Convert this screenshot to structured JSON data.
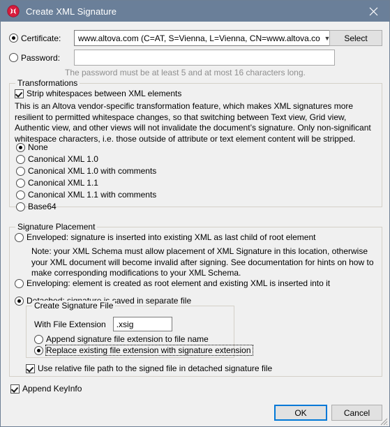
{
  "window": {
    "title": "Create XML Signature",
    "app_icon": "altova-x-icon",
    "close_icon": "close-icon",
    "titlebar_color": "#6a7f99",
    "accent_color": "#0078d7"
  },
  "certificate": {
    "radio_label": "Certificate:",
    "selected": true,
    "combo_value": "www.altova.com (C=AT, S=Vienna, L=Vienna, CN=www.altova.com/Ser",
    "combo_arrow_icon": "chevron-down-icon",
    "select_button": "Select"
  },
  "password": {
    "radio_label": "Password:",
    "selected": false,
    "value": "",
    "placeholder": "",
    "hint": "The password must be at least 5 and at most 16 characters long."
  },
  "transformations": {
    "group_title": "Transformations",
    "strip_whitespaces": {
      "label": "Strip whitespaces between XML elements",
      "checked": true
    },
    "description": "This is an Altova vendor-specific transformation feature, which makes XML signatures more resilient to permitted whitespace changes, so that switching between Text view, Grid view, Authentic view, and other views will not invalidate the document’s signature. Only non-significant whitespace characters, i.e. those outside of attribute or text element content will be stripped.",
    "options": [
      {
        "label": "None",
        "selected": true
      },
      {
        "label": "Canonical XML 1.0",
        "selected": false
      },
      {
        "label": "Canonical XML 1.0 with comments",
        "selected": false
      },
      {
        "label": "Canonical XML 1.1",
        "selected": false
      },
      {
        "label": "Canonical XML 1.1 with comments",
        "selected": false
      },
      {
        "label": "Base64",
        "selected": false
      }
    ]
  },
  "signature_placement": {
    "group_title": "Signature Placement",
    "enveloped": {
      "label": "Enveloped: signature is inserted into existing XML as last child of root element",
      "selected": false,
      "note": "Note: your XML Schema must allow placement of XML Signature in this location, otherwise your XML document will become invalid after signing. See documentation for hints on how to make corresponding modifications to your XML Schema."
    },
    "enveloping": {
      "label": "Enveloping: element is created as root element and existing XML is inserted into it",
      "selected": false
    },
    "detached": {
      "label": "Detached: signature is saved in separate file",
      "selected": true
    },
    "create_signature_file": {
      "group_title": "Create Signature File",
      "extension_label": "With File Extension",
      "extension_value": ".xsig",
      "append_option": {
        "label": "Append signature file extension to file name",
        "selected": false
      },
      "replace_option": {
        "label": "Replace existing file extension with signature extension",
        "selected": true,
        "focused": true
      }
    },
    "use_relative_path": {
      "label": "Use relative file path to the signed file in detached signature file",
      "checked": true
    }
  },
  "append_keyinfo": {
    "label": "Append KeyInfo",
    "checked": true
  },
  "footer": {
    "ok_label": "OK",
    "cancel_label": "Cancel",
    "resize_grip_icon": "resize-grip-icon"
  }
}
